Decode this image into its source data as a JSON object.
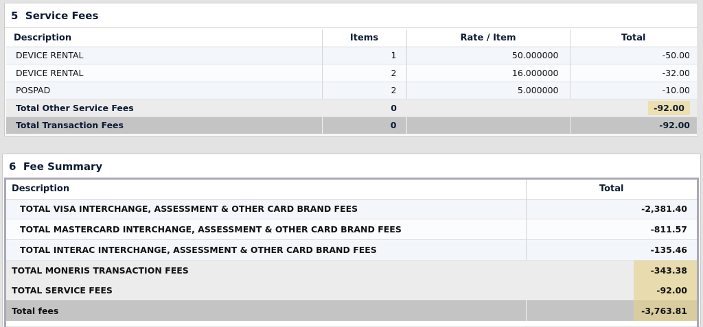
{
  "service_fees": {
    "section_number": "5",
    "title": "Service Fees",
    "columns": [
      "Description",
      "Items",
      "Rate / Item",
      "Total"
    ],
    "rows": [
      {
        "description": "DEVICE RENTAL",
        "items": "1",
        "rate": "50.000000",
        "total": "-50.00"
      },
      {
        "description": "DEVICE RENTAL",
        "items": "2",
        "rate": "16.000000",
        "total": "-32.00"
      },
      {
        "description": "POSPAD",
        "items": "2",
        "rate": "5.000000",
        "total": "-10.00"
      }
    ],
    "subtotal": {
      "label": "Total Other Service Fees",
      "items": "0",
      "total": "-92.00"
    },
    "grand_total": {
      "label": "Total Transaction Fees",
      "items": "0",
      "total": "-92.00"
    }
  },
  "fee_summary": {
    "section_number": "6",
    "title": "Fee Summary",
    "columns": [
      "Description",
      "Total"
    ],
    "brand_rows": [
      {
        "description": "TOTAL VISA INTERCHANGE, ASSESSMENT & OTHER CARD BRAND FEES",
        "total": "-2,381.40"
      },
      {
        "description": "TOTAL MASTERCARD INTERCHANGE, ASSESSMENT & OTHER CARD BRAND FEES",
        "total": "-811.57"
      },
      {
        "description": "TOTAL INTERAC INTERCHANGE, ASSESSMENT & OTHER CARD BRAND FEES",
        "total": "-135.46"
      }
    ],
    "other_rows": [
      {
        "description": "TOTAL MONERIS TRANSACTION FEES",
        "total": "-343.38"
      },
      {
        "description": "TOTAL SERVICE FEES",
        "total": "-92.00"
      }
    ],
    "final": {
      "label": "Total fees",
      "total": "-3,763.81"
    }
  },
  "colors": {
    "highlight": "#ece0b1",
    "heading_text": "#0b1a33",
    "grand_row": "#c4c4c4",
    "subtotal_row": "#ececec"
  }
}
